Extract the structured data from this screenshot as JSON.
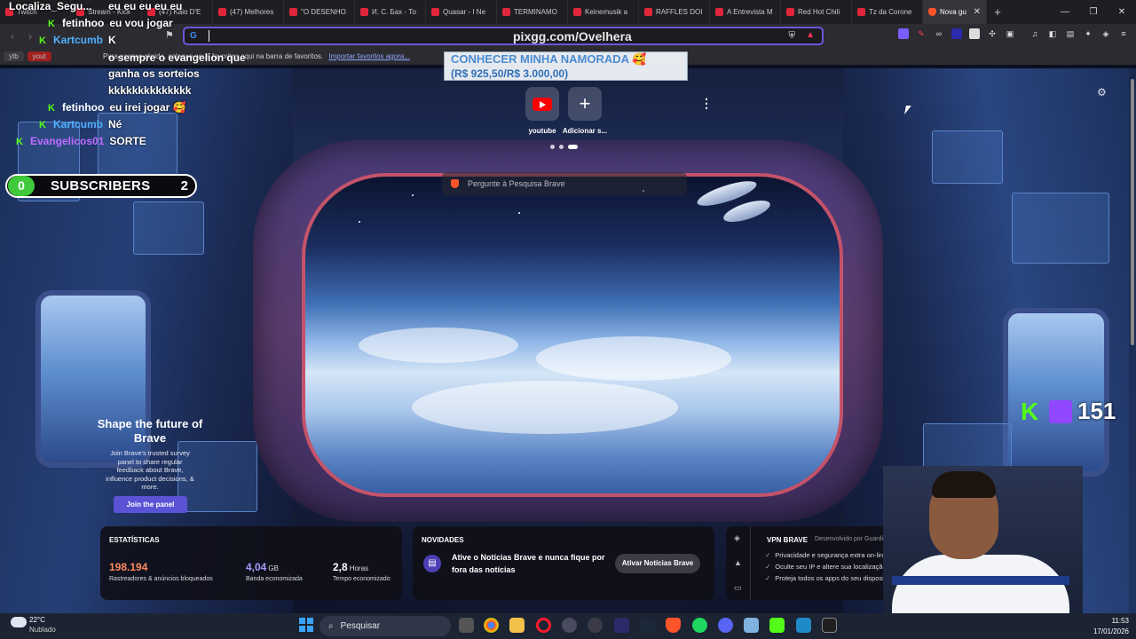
{
  "stream": {
    "title": "Localiza_Segu...",
    "chat": [
      {
        "user": "",
        "message": "eu eu eu eu eu",
        "color": "#ffffff"
      },
      {
        "user": "fetinhoo",
        "message": "eu vou jogar",
        "color": "#ffffff"
      },
      {
        "user": "Kartcumb",
        "message": "K",
        "color": "#4fb0ff"
      },
      {
        "user": "",
        "message": "o sempre o evangelion que",
        "color": "#ffffff"
      },
      {
        "user": "",
        "message": "ganha os sorteios",
        "color": "#ffffff"
      },
      {
        "user": "",
        "message": "kkkkkkkkkkkkkk",
        "color": "#ffffff"
      },
      {
        "user": "fetinhoo",
        "message": "eu irei jogar 🥰",
        "color": "#ffffff"
      },
      {
        "user": "Kartcumb",
        "message": "Né",
        "color": "#4fb0ff"
      },
      {
        "user": "Evangelicos01",
        "message": "SORTE",
        "color": "#c06bff"
      }
    ],
    "subscribers": {
      "current": "0",
      "label": "SUBSCRIBERS",
      "goal": "2"
    },
    "donation": {
      "line1": "CONHECER MINHA NAMORADA 🥰",
      "line2": "(R$ 925,50/R$ 3.000,00)"
    },
    "viewer_count": "151",
    "url_overlay": "pixgg.com/Ovelhera"
  },
  "browser": {
    "tabs": [
      {
        "label": "Twitch",
        "active": false
      },
      {
        "label": "Stream - Kick",
        "active": false
      },
      {
        "label": "(47) Kaio D'E",
        "active": false
      },
      {
        "label": "(47) Melhores",
        "active": false
      },
      {
        "label": "\"O DESENHO",
        "active": false
      },
      {
        "label": "И. С. Бах - То",
        "active": false
      },
      {
        "label": "Quasar - I Ne",
        "active": false
      },
      {
        "label": "TERMINAMO",
        "active": false
      },
      {
        "label": "Keinemusik a",
        "active": false
      },
      {
        "label": "RAFFLES DOI",
        "active": false
      },
      {
        "label": "A Entrevista M",
        "active": false
      },
      {
        "label": "Red Hot Chili",
        "active": false
      },
      {
        "label": "Tz da Corone",
        "active": false
      },
      {
        "label": "Nova gu",
        "active": true
      }
    ],
    "new_tab_label": "+",
    "window_controls": {
      "minimize": "—",
      "maximize": "❐",
      "close": "✕"
    },
    "address": {
      "value": "",
      "placeholder": ""
    },
    "bookmarks": {
      "items": [
        "ytb",
        "yout"
      ],
      "hint": "Para acesso rápido, coloque seus favoritos aqui na barra de favoritos.",
      "import_link": "Importar favoritos agora..."
    }
  },
  "newtab": {
    "top_sites": [
      {
        "label": "youtube",
        "icon": "youtube-icon"
      },
      {
        "label": "Adicionar s...",
        "icon": "plus-icon"
      }
    ],
    "search_placeholder": "Pergunte à Pesquisa Brave",
    "promo": {
      "title": "Shape the future of Brave",
      "body": "Join Brave's trusted survey panel to share regular feedback about Brave, influence product decisions, & more.",
      "button": "Join the panel"
    },
    "stats": {
      "title": "ESTATÍSTICAS",
      "items": [
        {
          "value": "198.194",
          "unit": "",
          "label": "Rastreadores & anúncios bloqueados",
          "color": "#ff8a5b"
        },
        {
          "value": "4,04",
          "unit": "GB",
          "label": "Banda economizada",
          "color": "#a99cff"
        },
        {
          "value": "2,8",
          "unit": "Horas",
          "label": "Tempo economizado",
          "color": "#ffffff"
        }
      ]
    },
    "news": {
      "title": "NOVIDADES",
      "text": "Ative o Notícias Brave e nunca fique por fora das notícias",
      "button": "Ativar Notícias Brave"
    },
    "vpn": {
      "title": "VPN BRAVE",
      "by": "Desenvolvido por Guardian",
      "features": [
        "Privacidade e segurança extra on-line",
        "Oculte seu IP e altere sua localização",
        "Proteja todos os apps do seu dispositivo"
      ]
    }
  },
  "taskbar": {
    "weather": {
      "temp": "22°C",
      "desc": "Nublado"
    },
    "search_label": "Pesquisar",
    "clock": {
      "time": "11:53",
      "date": "17/01/2026"
    }
  },
  "colors": {
    "brave_orange": "#fb542b",
    "kick_green": "#53fc18",
    "brave_purple": "#5a53d6"
  }
}
